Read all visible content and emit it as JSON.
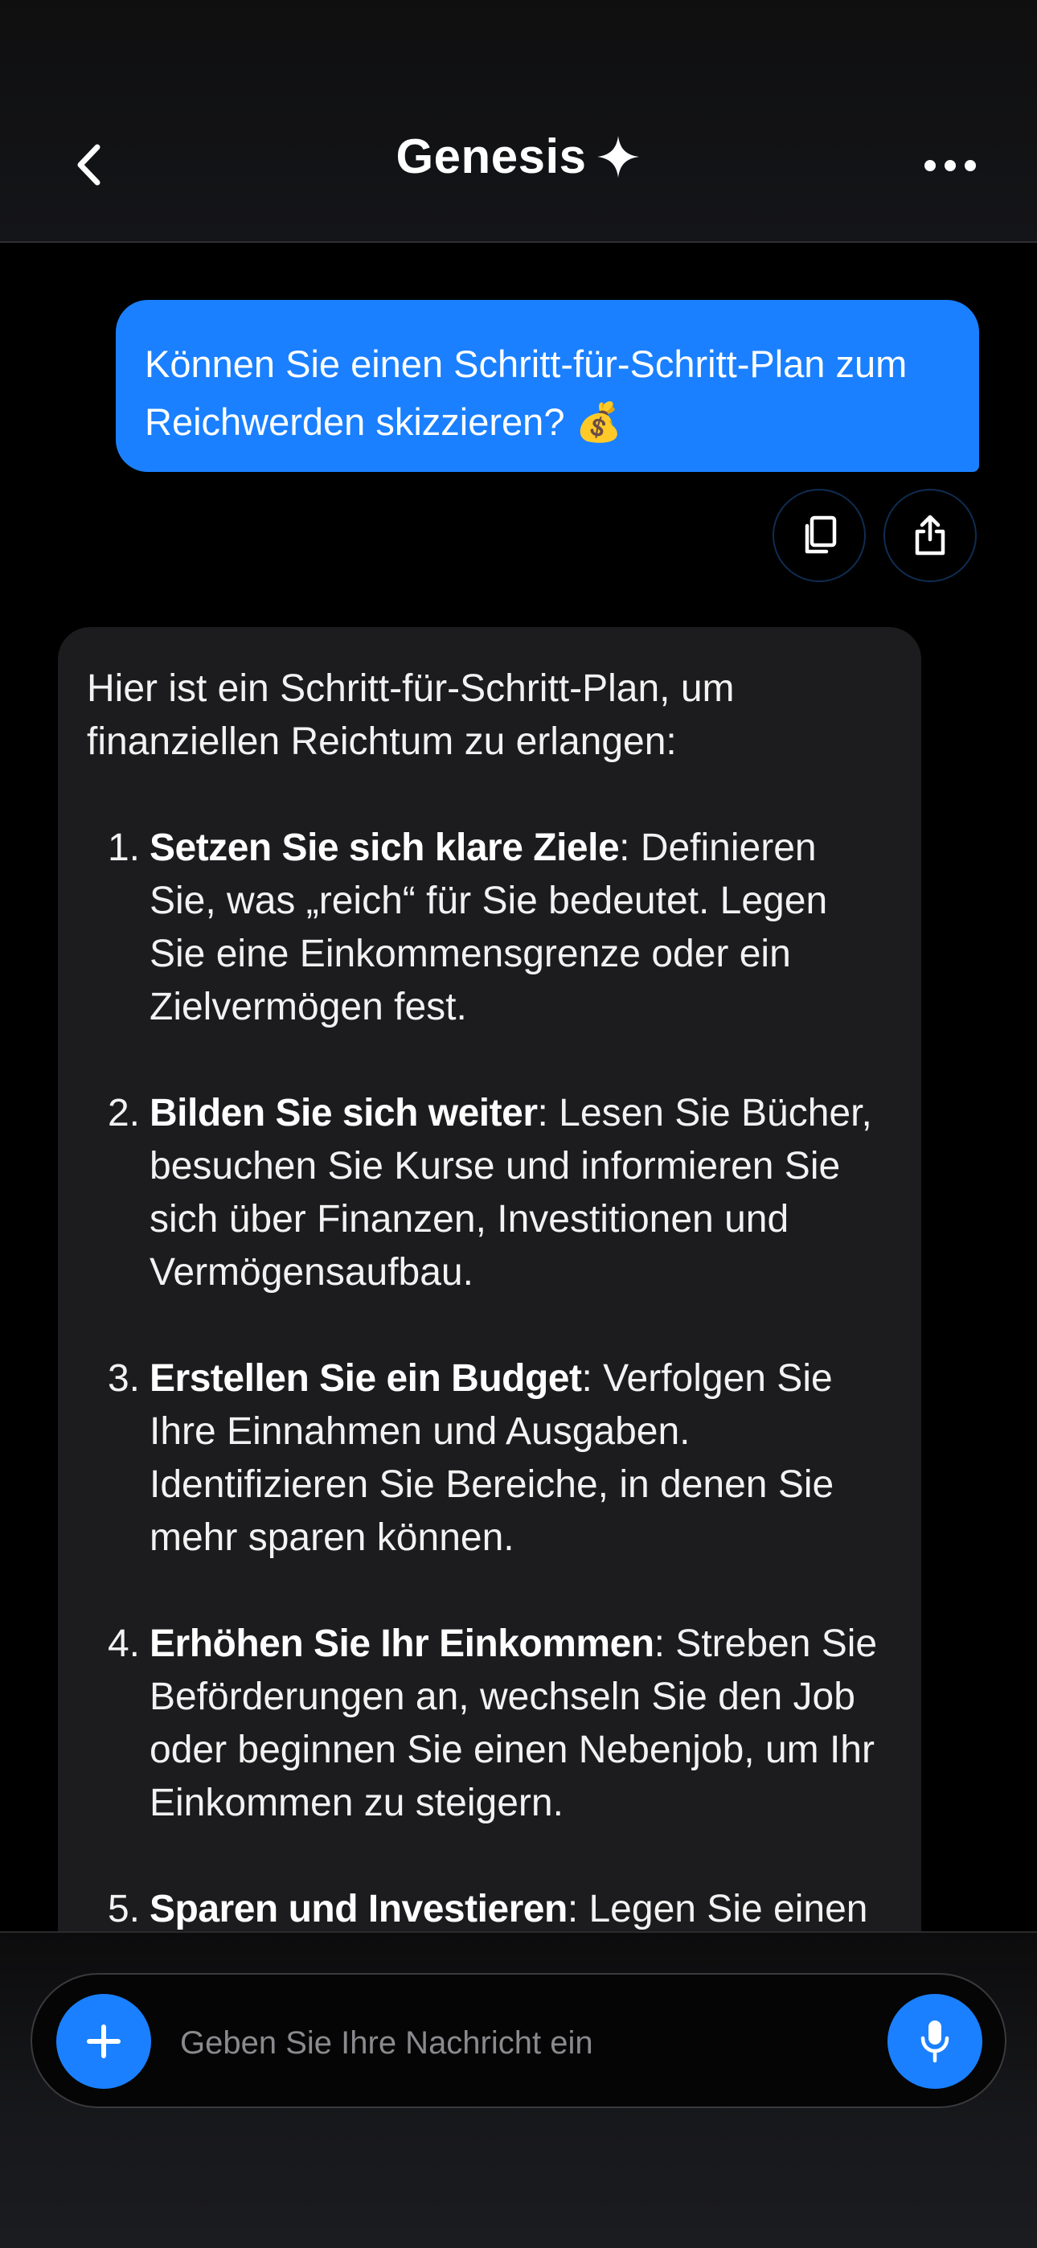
{
  "header": {
    "title": "Genesis",
    "title_icon": "sparkle-icon",
    "back_icon": "chevron-left-icon",
    "more_icon": "ellipsis-icon"
  },
  "user_message": {
    "text": "Können Sie einen Schritt-für-Schritt-Plan zum Reichwerden skizzieren? 💰",
    "actions": [
      "copy-icon",
      "share-icon"
    ]
  },
  "assistant_message": {
    "intro": "Hier ist ein Schritt-für-Schritt-Plan, um finanziellen Reichtum zu erlangen:",
    "steps": [
      {
        "number": "1.",
        "title": "Setzen Sie sich klare Ziele",
        "text": ": Definieren Sie, was „reich“ für Sie bedeutet. Legen Sie eine Einkommensgrenze oder ein Zielvermögen fest."
      },
      {
        "number": "2.",
        "title": "Bilden Sie sich weiter",
        "text": ": Lesen Sie Bücher, besuchen Sie Kurse und informieren Sie sich über Finanzen, Investitionen und Vermögensaufbau."
      },
      {
        "number": "3.",
        "title": "Erstellen Sie ein Budget",
        "text": ": Verfolgen Sie Ihre Einnahmen und Ausgaben. Identifizieren Sie Bereiche, in denen Sie mehr sparen können."
      },
      {
        "number": "4.",
        "title": "Erhöhen Sie Ihr Einkommen",
        "text": ": Streben Sie Beförderungen an, wechseln Sie den Job oder beginnen Sie einen Nebenjob, um Ihr Einkommen zu steigern."
      },
      {
        "number": "5.",
        "title": "Sparen und Investieren",
        "text": ": Legen Sie einen"
      }
    ]
  },
  "composer": {
    "placeholder": "Geben Sie Ihre Nachricht ein",
    "value": "",
    "plus_icon": "plus-icon",
    "mic_icon": "microphone-icon"
  },
  "colors": {
    "accent": "#1a80ff",
    "background": "#000000",
    "assistant_bubble": "#1c1c1e"
  }
}
